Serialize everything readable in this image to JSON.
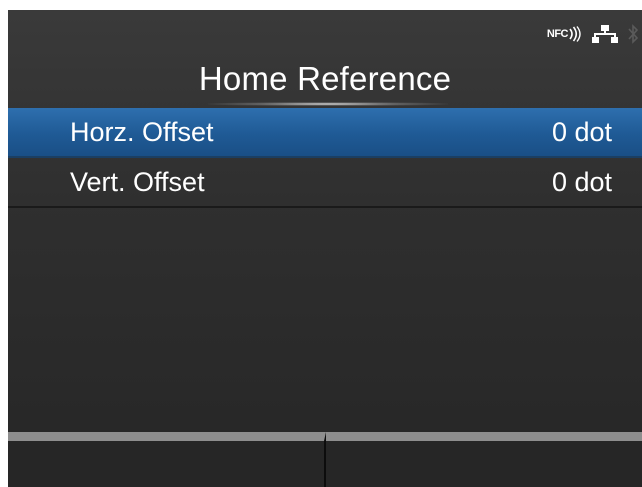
{
  "status": {
    "nfc_label": "NFC",
    "nfc_icon": "nfc-wave-icon",
    "network_icon": "wired-network-icon",
    "bluetooth_icon": "bluetooth-icon"
  },
  "title": "Home Reference",
  "menu": {
    "items": [
      {
        "label": "Horz. Offset",
        "value": "0 dot",
        "selected": true
      },
      {
        "label": "Vert. Offset",
        "value": "0 dot",
        "selected": false
      }
    ]
  },
  "softkeys": {
    "left_label": "",
    "right_label": ""
  },
  "colors": {
    "background": "#2f2f2f",
    "selected_row": "#1f5a95",
    "text": "#ffffff",
    "softkey_bar": "#8e8e8e"
  }
}
